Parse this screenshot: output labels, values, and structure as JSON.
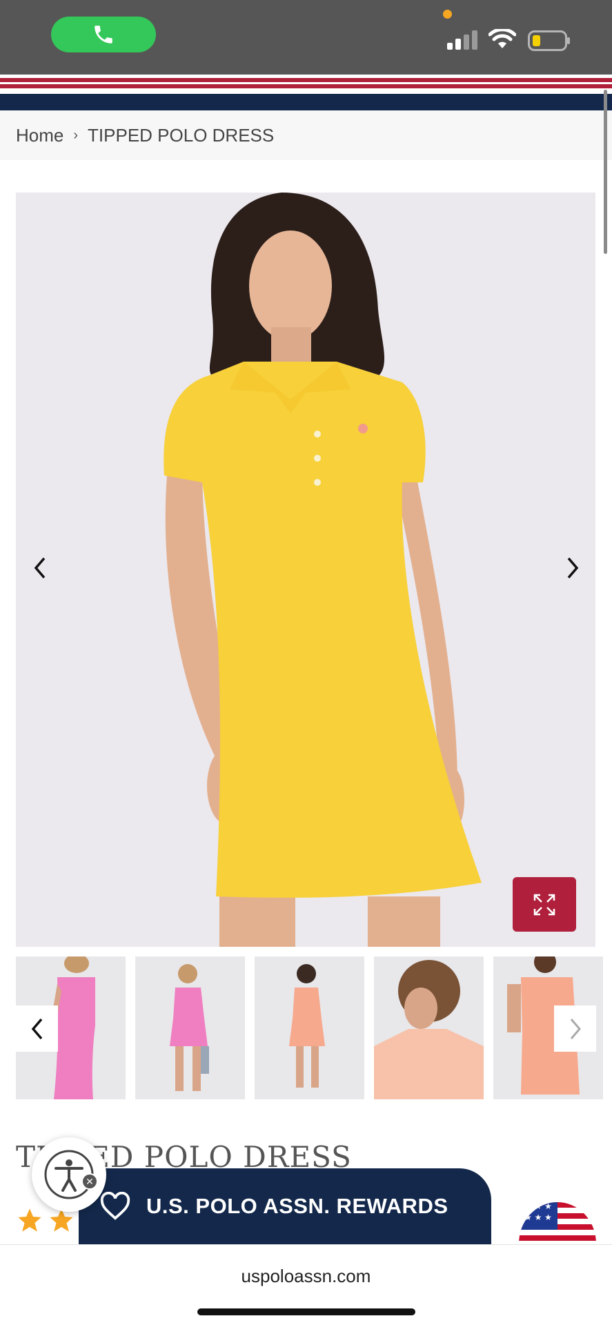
{
  "breadcrumb": {
    "home": "Home",
    "separator": "›",
    "current": "TIPPED POLO DRESS"
  },
  "product": {
    "title": "TIPPED POLO DRESS",
    "rating_stars": 2,
    "main_image": "yellow tipped polo dress on model",
    "thumbnails": [
      "pink dress side view",
      "pink dress full body",
      "peach dress full body",
      "peach dress collar detail",
      "peach dress back view"
    ]
  },
  "rewards": {
    "label": "U.S. POLO ASSN. REWARDS",
    "icon": "heart-icon"
  },
  "browser": {
    "url": "uspoloassn.com"
  },
  "colors": {
    "navy": "#13284b",
    "red": "#b01f3b",
    "dress_yellow": "#f7d03a",
    "call_green": "#34c759",
    "star": "#f6a623"
  },
  "icons": {
    "call": "phone-icon",
    "prev": "chevron-left-icon",
    "next": "chevron-right-icon",
    "zoom": "expand-icon",
    "accessibility": "accessibility-icon",
    "flag": "us-flag-icon"
  }
}
